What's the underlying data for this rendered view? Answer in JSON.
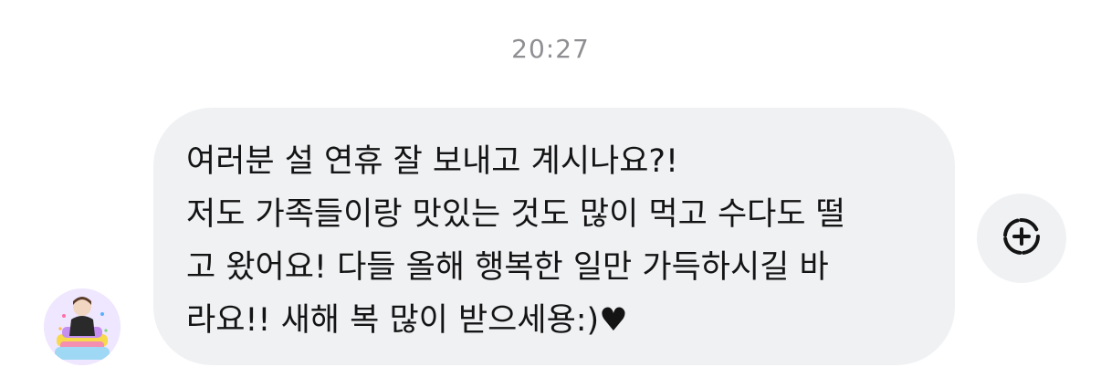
{
  "chat": {
    "timestamp": "20:27",
    "message": {
      "lines": [
        "여러분 설 연휴 잘 보내고 계시나요?!",
        "저도 가족들이랑 맛있는 것도 많이 먹고 수다도 떨",
        "고 왔어요! 다들 올해 행복한 일만 가득하시길 바",
        "라요!! 새해 복 많이 받으세용:)"
      ],
      "trailing_icon": "♥"
    },
    "icons": {
      "avatar": "profile-avatar-icon",
      "react": "add-reaction-icon"
    },
    "colors": {
      "bubble_bg": "#eff1f3",
      "text": "#141414",
      "timestamp": "#8e8e93"
    }
  }
}
